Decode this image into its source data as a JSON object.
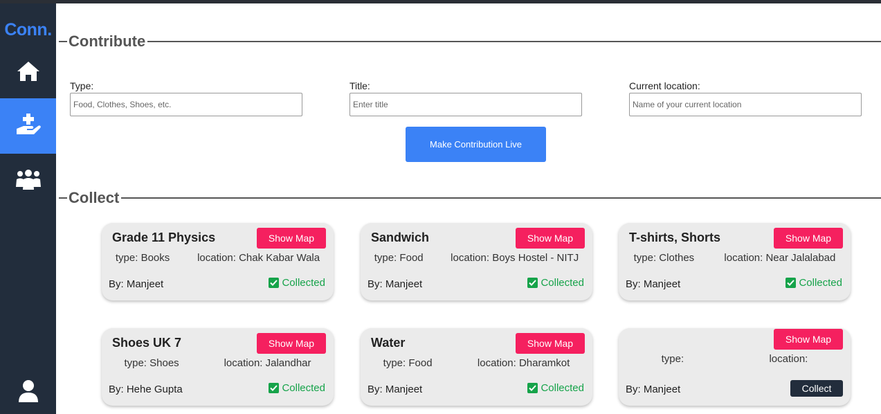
{
  "brand": "Conn.",
  "sidebar": {
    "items": [
      {
        "icon": "home-icon"
      },
      {
        "icon": "hand-plus-icon",
        "active": true
      },
      {
        "icon": "people-icon"
      },
      {
        "icon": "user-icon"
      }
    ]
  },
  "contribute": {
    "heading": "Contribute",
    "type_label": "Type:",
    "type_placeholder": "Food, Clothes, Shoes, etc.",
    "title_label": "Title:",
    "title_placeholder": "Enter title",
    "location_label": "Current location:",
    "location_placeholder": "Name of your current location",
    "submit_label": "Make Contribution Live"
  },
  "collect": {
    "heading": "Collect",
    "map_label": "Show Map",
    "collected_label": "Collected",
    "collect_label": "Collect",
    "cards": [
      {
        "title": "Grade 11 Physics",
        "type": "type: Books",
        "location": "location: Chak Kabar Wala",
        "by": "By: Manjeet",
        "status": "collected"
      },
      {
        "title": "Sandwich",
        "type": "type: Food",
        "location": "location: Boys Hostel - NITJ",
        "by": "By: Manjeet",
        "status": "collected"
      },
      {
        "title": "T-shirts, Shorts",
        "type": "type: Clothes",
        "location": "location: Near Jalalabad",
        "by": "By: Manjeet",
        "status": "collected"
      },
      {
        "title": "Shoes UK 7",
        "type": "type: Shoes",
        "location": "location: Jalandhar",
        "by": "By: Hehe Gupta",
        "status": "collected"
      },
      {
        "title": "Water",
        "type": "type: Food",
        "location": "location: Dharamkot",
        "by": "By: Manjeet",
        "status": "collected"
      },
      {
        "title": "",
        "type": "type:",
        "location": "location:",
        "by": "By: Manjeet",
        "status": "available"
      }
    ]
  },
  "colors": {
    "sidebar": "#222d3c",
    "accent": "#3b82f6",
    "map_button": "#f5205f",
    "collected": "#16a34a"
  }
}
